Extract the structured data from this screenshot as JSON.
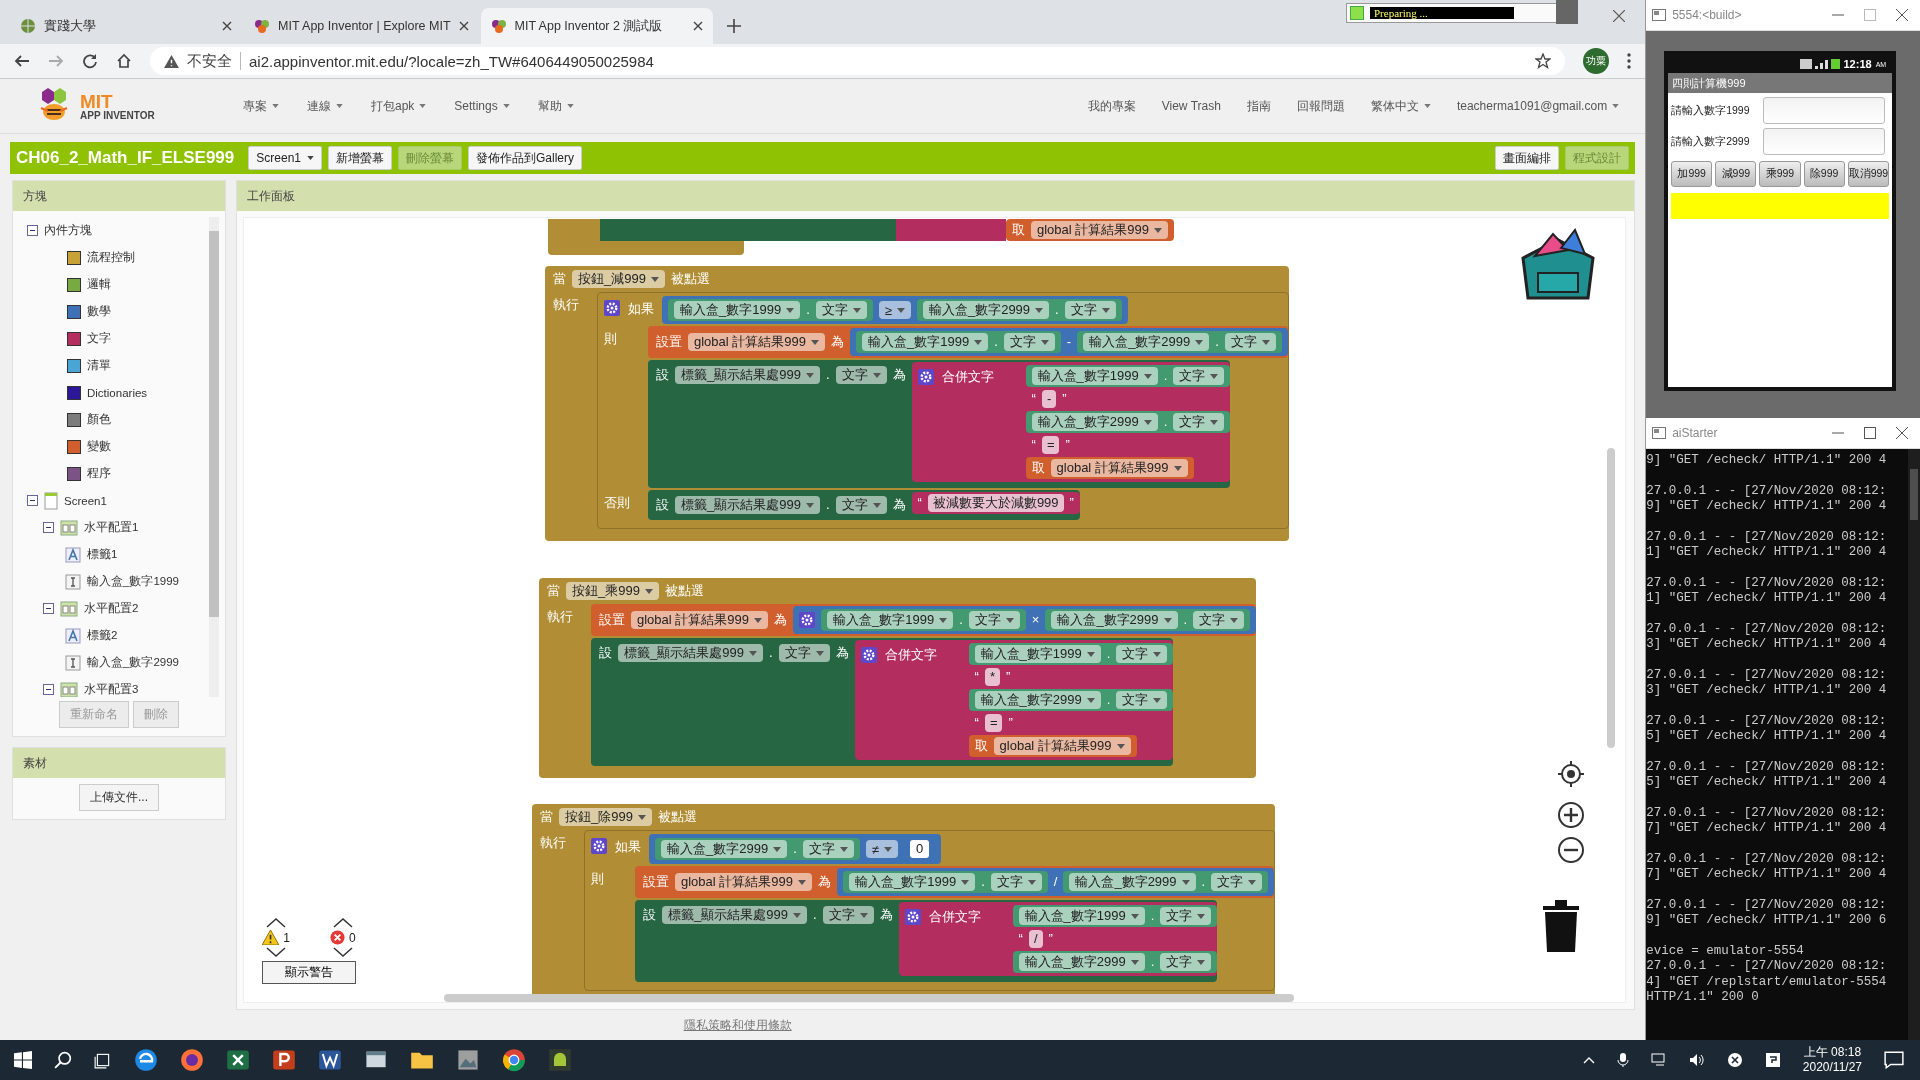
{
  "browser": {
    "tabs": [
      {
        "title": "實踐大學",
        "selected": false
      },
      {
        "title": "MIT App Inventor | Explore MIT",
        "selected": false
      },
      {
        "title": "MIT App Inventor 2 測試版",
        "selected": true
      }
    ],
    "security": "不安全",
    "url": "ai2.appinventor.mit.edu/?locale=zh_TW#6406449050025984",
    "profile": "功粟"
  },
  "progress_popup": {
    "text": "Preparing ..."
  },
  "header": {
    "logo": {
      "title": "MIT",
      "subtitle": "APP INVENTOR"
    },
    "menus": [
      {
        "label": "專案",
        "dropdown": true
      },
      {
        "label": "連線",
        "dropdown": true
      },
      {
        "label": "打包apk",
        "dropdown": true
      },
      {
        "label": "Settings",
        "dropdown": true
      },
      {
        "label": "幫助",
        "dropdown": true
      }
    ],
    "right_menus": [
      {
        "label": "我的專案",
        "dropdown": false
      },
      {
        "label": "View Trash",
        "dropdown": false
      },
      {
        "label": "指南",
        "dropdown": false
      },
      {
        "label": "回報問題",
        "dropdown": false
      },
      {
        "label": "繁体中文",
        "dropdown": true
      },
      {
        "label": "teacherma1091@gmail.com",
        "dropdown": true
      }
    ]
  },
  "toolbar": {
    "project": "CH06_2_Math_IF_ELSE999",
    "buttons": [
      {
        "label": "Screen1",
        "dropdown": true,
        "disabled": false
      },
      {
        "label": "新增螢幕",
        "dropdown": false,
        "disabled": false
      },
      {
        "label": "刪除螢幕",
        "dropdown": false,
        "disabled": true
      },
      {
        "label": "發佈作品到Gallery",
        "dropdown": false,
        "disabled": false
      }
    ],
    "modes": [
      {
        "label": "畫面編排",
        "selected": false
      },
      {
        "label": "程式設計",
        "selected": true
      }
    ]
  },
  "blocks_panel": {
    "title": "方塊",
    "tree": [
      {
        "label": "內件方塊",
        "kind": "folder",
        "expanded": true,
        "children": [
          {
            "label": "流程控制",
            "kind": "category",
            "color": "#c8a236"
          },
          {
            "label": "邏輯",
            "kind": "category",
            "color": "#77ab41"
          },
          {
            "label": "數學",
            "kind": "category",
            "color": "#3f71b5"
          },
          {
            "label": "文字",
            "kind": "category",
            "color": "#b32d5e"
          },
          {
            "label": "清單",
            "kind": "category",
            "color": "#49a6d4"
          },
          {
            "label": "Dictionaries",
            "kind": "category",
            "color": "#2d1799"
          },
          {
            "label": "顏色",
            "kind": "category",
            "color": "#7d7d7d"
          },
          {
            "label": "變數",
            "kind": "category",
            "color": "#d05f2d"
          },
          {
            "label": "程序",
            "kind": "category",
            "color": "#7c5385"
          }
        ]
      },
      {
        "label": "Screen1",
        "kind": "screen",
        "expanded": true,
        "children": [
          {
            "label": "水平配置1",
            "kind": "arrangement",
            "expanded": true,
            "children": [
              {
                "label": "標籤1",
                "kind": "label"
              },
              {
                "label": "輸入盒_數字1999",
                "kind": "textbox"
              }
            ]
          },
          {
            "label": "水平配置2",
            "kind": "arrangement",
            "expanded": true,
            "children": [
              {
                "label": "標籤2",
                "kind": "label"
              },
              {
                "label": "輸入盒_數字2999",
                "kind": "textbox"
              }
            ]
          },
          {
            "label": "水平配置3",
            "kind": "arrangement",
            "expanded": true
          }
        ]
      }
    ],
    "buttons": [
      {
        "label": "重新命名",
        "disabled": true
      },
      {
        "label": "刪除",
        "disabled": true
      }
    ]
  },
  "media_panel": {
    "title": "素材",
    "button": "上傳文件..."
  },
  "workspace": {
    "title": "工作面板",
    "blocks": [
      {
        "kind": "fragment",
        "label": "取",
        "var": "global 計算結果999"
      },
      {
        "kind": "event",
        "when": "當",
        "component": "按鈕_減999",
        "event": "被點選",
        "do": "執行",
        "body": [
          {
            "kind": "if",
            "if_label": "如果",
            "condition": {
              "kind": "compare",
              "left": {
                "kind": "getter",
                "component": "輸入盒_數字1999",
                "dot": ".",
                "prop": "文字"
              },
              "op": "≥",
              "right": {
                "kind": "getter",
                "component": "輸入盒_數字2999",
                "dot": ".",
                "prop": "文字"
              }
            },
            "then_label": "則",
            "then": [
              {
                "kind": "set_global",
                "label": "設置",
                "var": "global 計算結果999",
                "to": "為",
                "value": {
                  "kind": "arith",
                  "left": {
                    "kind": "getter",
                    "component": "輸入盒_數字1999",
                    "dot": ".",
                    "prop": "文字"
                  },
                  "op": "-",
                  "right": {
                    "kind": "getter",
                    "component": "輸入盒_數字2999",
                    "dot": ".",
                    "prop": "文字"
                  }
                }
              },
              {
                "kind": "set_prop",
                "label": "設",
                "component": "標籤_顯示結果處999",
                "dot": ".",
                "prop": "文字",
                "to": "為",
                "value": {
                  "kind": "join",
                  "label": "合併文字",
                  "items": [
                    {
                      "kind": "getter",
                      "component": "輸入盒_數字1999",
                      "dot": ".",
                      "prop": "文字"
                    },
                    {
                      "kind": "text",
                      "open": "“",
                      "value": "-",
                      "close": "”"
                    },
                    {
                      "kind": "getter",
                      "component": "輸入盒_數字2999",
                      "dot": ".",
                      "prop": "文字"
                    },
                    {
                      "kind": "text",
                      "open": "“",
                      "value": "=",
                      "close": "”"
                    },
                    {
                      "kind": "get",
                      "label": "取",
                      "var": "global 計算結果999"
                    }
                  ]
                }
              }
            ],
            "else_label": "否則",
            "else": [
              {
                "kind": "set_prop",
                "label": "設",
                "component": "標籤_顯示結果處999",
                "dot": ".",
                "prop": "文字",
                "to": "為",
                "value": {
                  "kind": "text",
                  "open": "“",
                  "value": "被減數要大於減數999",
                  "close": "”"
                }
              }
            ]
          }
        ]
      },
      {
        "kind": "event",
        "when": "當",
        "component": "按鈕_乘999",
        "event": "被點選",
        "do": "執行",
        "body": [
          {
            "kind": "set_global",
            "label": "設置",
            "var": "global 計算結果999",
            "to": "為",
            "value": {
              "kind": "arith",
              "mutator": true,
              "left": {
                "kind": "getter",
                "component": "輸入盒_數字1999",
                "dot": ".",
                "prop": "文字"
              },
              "op": "×",
              "right": {
                "kind": "getter",
                "component": "輸入盒_數字2999",
                "dot": ".",
                "prop": "文字"
              }
            }
          },
          {
            "kind": "set_prop",
            "label": "設",
            "component": "標籤_顯示結果處999",
            "dot": ".",
            "prop": "文字",
            "to": "為",
            "value": {
              "kind": "join",
              "label": "合併文字",
              "items": [
                {
                  "kind": "getter",
                  "component": "輸入盒_數字1999",
                  "dot": ".",
                  "prop": "文字"
                },
                {
                  "kind": "text",
                  "open": "“",
                  "value": "*",
                  "close": "”"
                },
                {
                  "kind": "getter",
                  "component": "輸入盒_數字2999",
                  "dot": ".",
                  "prop": "文字"
                },
                {
                  "kind": "text",
                  "open": "“",
                  "value": "=",
                  "close": "”"
                },
                {
                  "kind": "get",
                  "label": "取",
                  "var": "global 計算結果999"
                }
              ]
            }
          }
        ]
      },
      {
        "kind": "event",
        "when": "當",
        "component": "按鈕_除999",
        "event": "被點選",
        "do": "執行",
        "body": [
          {
            "kind": "if",
            "if_label": "如果",
            "condition": {
              "kind": "compare",
              "left": {
                "kind": "getter",
                "component": "輸入盒_數字2999",
                "dot": ".",
                "prop": "文字"
              },
              "op": "≠",
              "right": {
                "kind": "number",
                "value": "0"
              }
            },
            "then_label": "則",
            "then": [
              {
                "kind": "set_global",
                "label": "設置",
                "var": "global 計算結果999",
                "to": "為",
                "value": {
                  "kind": "arith",
                  "left": {
                    "kind": "getter",
                    "component": "輸入盒_數字1999",
                    "dot": ".",
                    "prop": "文字"
                  },
                  "op": "/",
                  "right": {
                    "kind": "getter",
                    "component": "輸入盒_數字2999",
                    "dot": ".",
                    "prop": "文字"
                  }
                }
              },
              {
                "kind": "set_prop",
                "label": "設",
                "component": "標籤_顯示結果處999",
                "dot": ".",
                "prop": "文字",
                "to": "為",
                "value": {
                  "kind": "join",
                  "label": "合併文字",
                  "items": [
                    {
                      "kind": "getter",
                      "component": "輸入盒_數字1999",
                      "dot": ".",
                      "prop": "文字"
                    },
                    {
                      "kind": "text",
                      "open": "“",
                      "value": "/",
                      "close": "”"
                    },
                    {
                      "kind": "getter",
                      "component": "輸入盒_數字2999",
                      "dot": ".",
                      "prop": "文字"
                    }
                  ]
                }
              }
            ]
          }
        ]
      }
    ],
    "warnings": {
      "warning_count": "1",
      "error_count": "0",
      "button": "顯示警告"
    }
  },
  "footer": {
    "link": "隱私策略和使用條款"
  },
  "emulator": {
    "title": "5554:<build>",
    "clock": "12:18",
    "ampm": "AM",
    "app_title": "四則計算機999",
    "fields": [
      {
        "label": "請輸入數字1999"
      },
      {
        "label": "請輸入數字2999"
      }
    ],
    "buttons": [
      "加999",
      "減999",
      "乘999",
      "除999",
      "取消999"
    ]
  },
  "console": {
    "title": "aiStarter",
    "entries": [
      [
        "9] \"GET /echeck/ HTTP/1.1\" 200 4"
      ],
      [
        "27.0.0.1 - - [27/Nov/2020 08:12:",
        "9] \"GET /echeck/ HTTP/1.1\" 200 4"
      ],
      [
        "27.0.0.1 - - [27/Nov/2020 08:12:",
        "1] \"GET /echeck/ HTTP/1.1\" 200 4"
      ],
      [
        "27.0.0.1 - - [27/Nov/2020 08:12:",
        "1] \"GET /echeck/ HTTP/1.1\" 200 4"
      ],
      [
        "27.0.0.1 - - [27/Nov/2020 08:12:",
        "3] \"GET /echeck/ HTTP/1.1\" 200 4"
      ],
      [
        "27.0.0.1 - - [27/Nov/2020 08:12:",
        "3] \"GET /echeck/ HTTP/1.1\" 200 4"
      ],
      [
        "27.0.0.1 - - [27/Nov/2020 08:12:",
        "5] \"GET /echeck/ HTTP/1.1\" 200 4"
      ],
      [
        "27.0.0.1 - - [27/Nov/2020 08:12:",
        "5] \"GET /echeck/ HTTP/1.1\" 200 4"
      ],
      [
        "27.0.0.1 - - [27/Nov/2020 08:12:",
        "7] \"GET /echeck/ HTTP/1.1\" 200 4"
      ],
      [
        "27.0.0.1 - - [27/Nov/2020 08:12:",
        "7] \"GET /echeck/ HTTP/1.1\" 200 4"
      ],
      [
        "27.0.0.1 - - [27/Nov/2020 08:12:",
        "9] \"GET /echeck/ HTTP/1.1\" 200 6"
      ],
      [
        "evice = emulator-5554",
        "27.0.0.1 - - [27/Nov/2020 08:12:",
        "4] \"GET /replstart/emulator-5554",
        "HTTP/1.1\" 200 0"
      ]
    ]
  },
  "taskbar": {
    "time": "上午 08:18",
    "date": "2020/11/27"
  }
}
